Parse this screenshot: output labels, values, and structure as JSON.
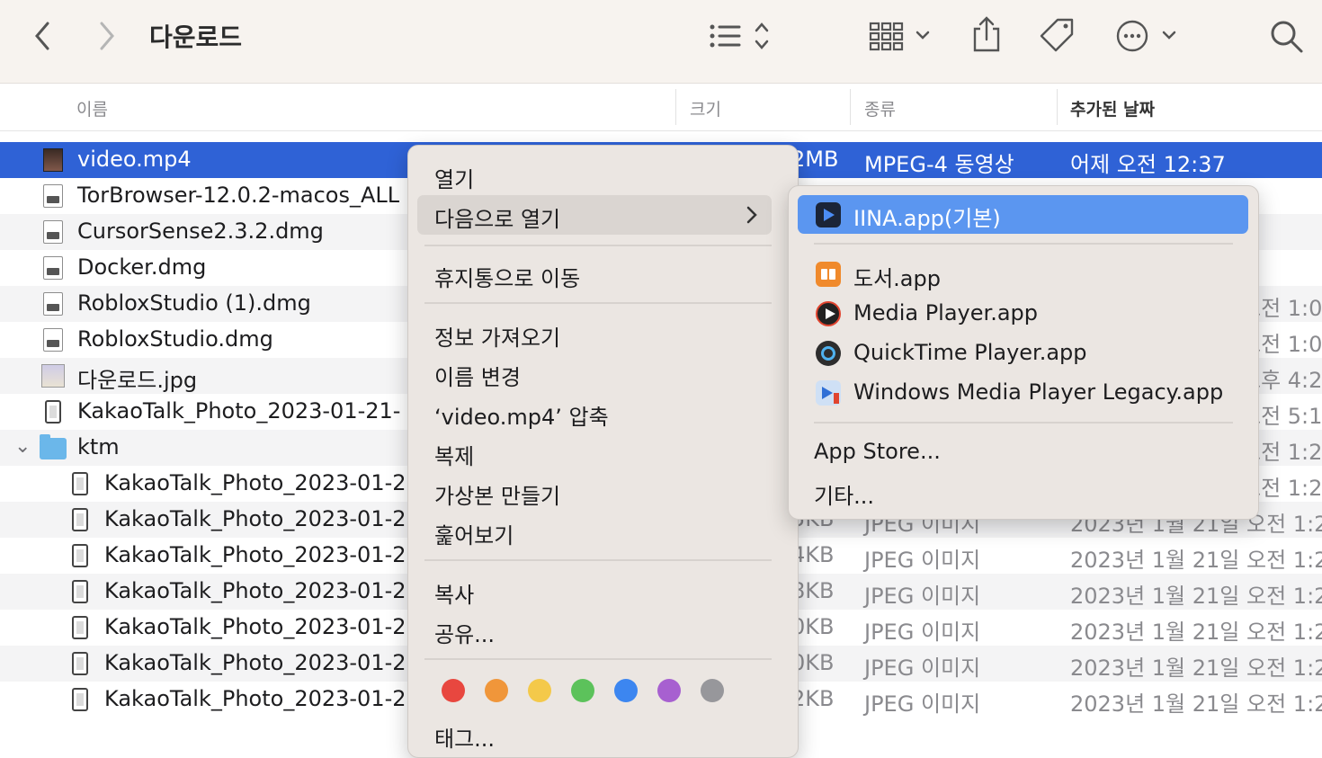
{
  "toolbar": {
    "title": "다운로드"
  },
  "columns": {
    "name": "이름",
    "size": "크기",
    "kind": "종류",
    "date_added": "추가된 날짜"
  },
  "rows": [
    {
      "name": "video.mp4",
      "size": "2MB",
      "kind": "MPEG-4 동영상",
      "date": "어제 오전 12:37"
    },
    {
      "name": "TorBrowser-12.0.2-macos_ALL",
      "size": "",
      "kind": "",
      "date": ""
    },
    {
      "name": "CursorSense2.3.2.dmg",
      "size": "",
      "kind": "",
      "date": ""
    },
    {
      "name": "Docker.dmg",
      "size": "",
      "kind": "",
      "date": ""
    },
    {
      "name": "RobloxStudio (1).dmg",
      "size": "",
      "kind": "",
      "date": "오전 1:0"
    },
    {
      "name": "RobloxStudio.dmg",
      "size": "",
      "kind": "",
      "date": "오전 1:0"
    },
    {
      "name": "다운로드.jpg",
      "size": "",
      "kind": "",
      "date": "오후 4:2"
    },
    {
      "name": "KakaoTalk_Photo_2023-01-21-",
      "size": "",
      "kind": "",
      "date": "오전 5:1"
    },
    {
      "name": "ktm",
      "size": "",
      "kind": "",
      "date": "오전 1:2"
    },
    {
      "name": "KakaoTalk_Photo_2023-01-2",
      "size": "",
      "kind": "",
      "date": "오전 1:2"
    },
    {
      "name": "KakaoTalk_Photo_2023-01-2",
      "size": "5KB",
      "kind": "JPEG 이미지",
      "date": "2023년 1월 21일 오전 1:2"
    },
    {
      "name": "KakaoTalk_Photo_2023-01-2",
      "size": "4KB",
      "kind": "JPEG 이미지",
      "date": "2023년 1월 21일 오전 1:2"
    },
    {
      "name": "KakaoTalk_Photo_2023-01-2",
      "size": "8KB",
      "kind": "JPEG 이미지",
      "date": "2023년 1월 21일 오전 1:2"
    },
    {
      "name": "KakaoTalk_Photo_2023-01-2",
      "size": "0KB",
      "kind": "JPEG 이미지",
      "date": "2023년 1월 21일 오전 1:2"
    },
    {
      "name": "KakaoTalk_Photo_2023-01-2",
      "size": "0KB",
      "kind": "JPEG 이미지",
      "date": "2023년 1월 21일 오전 1:2"
    },
    {
      "name": "KakaoTalk_Photo_2023-01-2",
      "size": "2KB",
      "kind": "JPEG 이미지",
      "date": "2023년 1월 21일 오전 1:2"
    }
  ],
  "context_menu": {
    "open": "열기",
    "open_with": "다음으로 열기",
    "trash": "휴지통으로 이동",
    "get_info": "정보 가져오기",
    "rename": "이름 변경",
    "compress": "‘video.mp4’ 압축",
    "duplicate": "복제",
    "make_alias": "가상본 만들기",
    "quick_look": "훑어보기",
    "copy": "복사",
    "share": "공유...",
    "tags": "태그...",
    "tag_colors": [
      "#e8473f",
      "#f0963a",
      "#f4c94a",
      "#5cc25b",
      "#3c86f0",
      "#a760d0",
      "#97979b"
    ]
  },
  "submenu": {
    "default_app": "IINA.app(기본)",
    "apps": [
      "도서.app",
      "Media Player.app",
      "QuickTime Player.app",
      "Windows Media Player Legacy.app"
    ],
    "app_store": "App Store...",
    "other": "기타..."
  }
}
